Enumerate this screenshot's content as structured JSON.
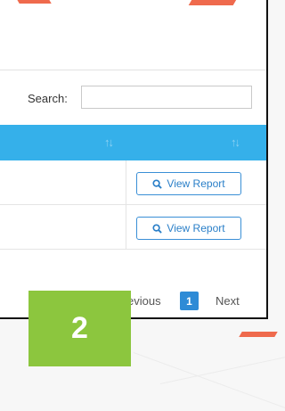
{
  "search": {
    "label": "Search:",
    "value": ""
  },
  "table": {
    "rows": [
      {
        "action_label": "View Report"
      },
      {
        "action_label": "View Report"
      }
    ]
  },
  "pagination": {
    "previous_label": "evious",
    "current_page": "1",
    "next_label": "Next"
  },
  "step_badge": {
    "number": "2"
  },
  "colors": {
    "table_header": "#35b0ea",
    "badge": "#8cc63e",
    "primary": "#2e8bd6",
    "accent_decoration": "#ef6a4d"
  },
  "icons": {
    "sort": "sort-icon",
    "view_report": "search-icon"
  }
}
